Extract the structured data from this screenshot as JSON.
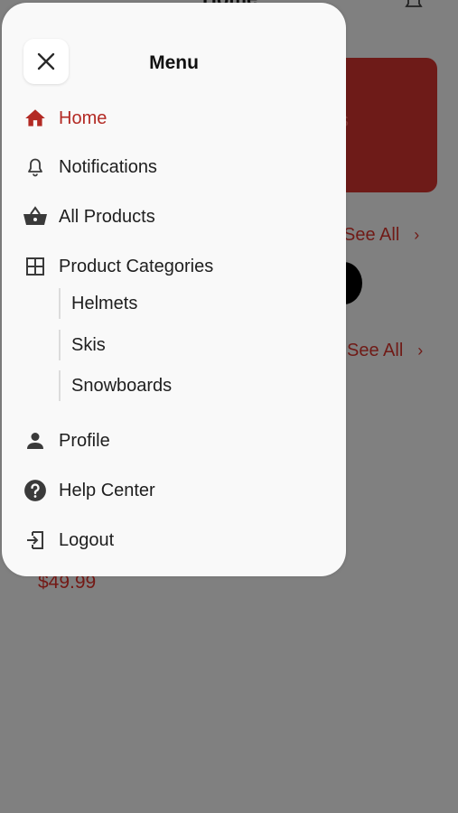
{
  "background": {
    "header_title": "Home",
    "banner_letter": "s",
    "see_all_1": "See All",
    "see_all_2": "See All",
    "chevron": "›",
    "price": "$49.99"
  },
  "drawer": {
    "title": "Menu",
    "close_icon": "close-icon",
    "items": [
      {
        "label": "Home",
        "icon": "home-icon",
        "active": true
      },
      {
        "label": "Notifications",
        "icon": "bell-icon"
      },
      {
        "label": "All Products",
        "icon": "basket-icon"
      },
      {
        "label": "Product Categories",
        "icon": "grid-icon"
      },
      {
        "label": "Profile",
        "icon": "person-icon"
      },
      {
        "label": "Help Center",
        "icon": "help-icon"
      },
      {
        "label": "Logout",
        "icon": "logout-icon"
      }
    ],
    "categories": [
      {
        "label": "Helmets"
      },
      {
        "label": "Skis"
      },
      {
        "label": "Snowboards"
      }
    ]
  },
  "colors": {
    "accent": "#b32a24",
    "overlay": "#808080",
    "drawer_bg": "#f9f9f9"
  }
}
